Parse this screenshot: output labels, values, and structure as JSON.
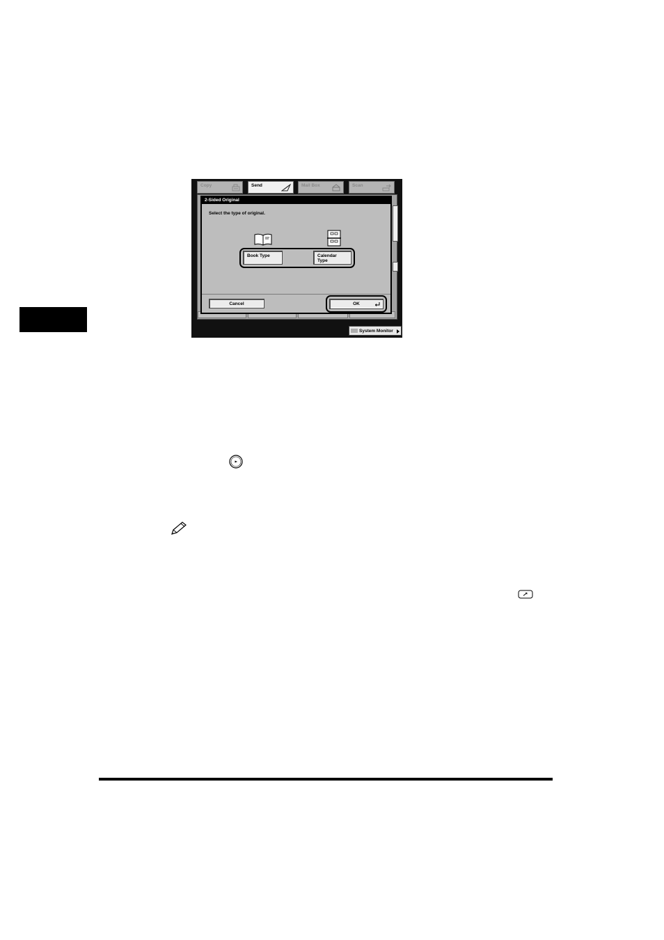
{
  "screen": {
    "tabs": [
      {
        "label": "Copy",
        "icon": "copy-icon",
        "active": false
      },
      {
        "label": "Send",
        "icon": "send-icon",
        "active": true
      },
      {
        "label": "Mail Box",
        "icon": "mailbox-icon",
        "active": false
      },
      {
        "label": "Scan",
        "icon": "scan-icon",
        "active": false
      }
    ],
    "dialog": {
      "title": "2-Sided Original",
      "instruction": "Select the type of original.",
      "options": [
        {
          "label": "Book Type",
          "icon": "book-type-icon"
        },
        {
          "label": "Calendar Type",
          "icon": "calendar-type-icon"
        }
      ],
      "cancel_label": "Cancel",
      "ok_label": "OK"
    },
    "system_monitor_label": "System Monitor"
  },
  "icons": {
    "start_key": "start-key-icon",
    "note": "note-pencil-icon",
    "reset_key": "reset-key-icon"
  },
  "colors": {
    "chapter_tab": "#000000",
    "dialog_bg": "#bdbdbd",
    "button_face": "#ececec",
    "screen_frame": "#111111"
  }
}
